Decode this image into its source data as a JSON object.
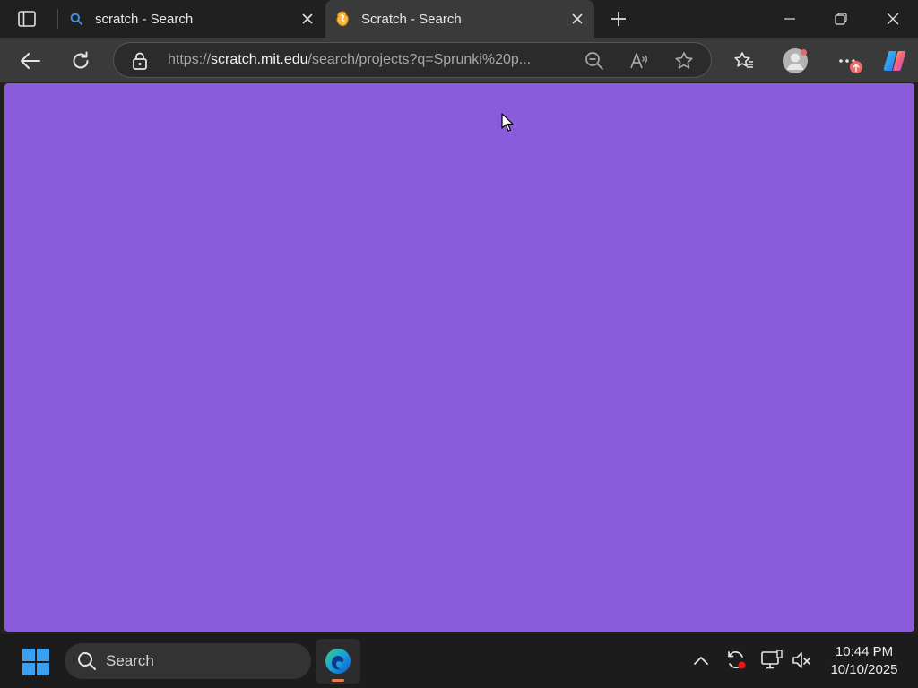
{
  "browser": {
    "tabs": [
      {
        "title": "scratch - Search",
        "active": false
      },
      {
        "title": "Scratch - Search",
        "active": true
      }
    ],
    "address": {
      "scheme": "https://",
      "host": "scratch.mit.edu",
      "path": "/search/projects?q=Sprunki%20p..."
    },
    "page_background": "#8a5cdb"
  },
  "taskbar": {
    "search_label": "Search",
    "time": "10:44 PM",
    "date": "10/10/2025"
  },
  "colors": {
    "tabstrip": "#202020",
    "toolbar": "#3a3a3a",
    "viewport": "#8a5cdb",
    "taskbar": "#1c1c1c",
    "badge": "#e86a6a"
  }
}
